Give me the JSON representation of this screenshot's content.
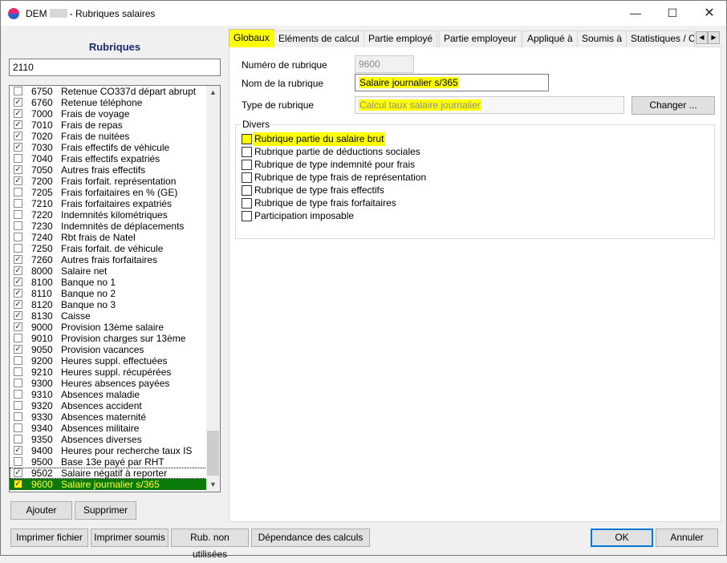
{
  "window": {
    "title_prefix": "DEM",
    "title_suffix": "- Rubriques salaires",
    "minimize": "—",
    "maximize": "☐",
    "close": "✕"
  },
  "left": {
    "header": "Rubriques",
    "search_value": "2110",
    "items": [
      {
        "code": "6750",
        "label": "Retenue CO337d départ abrupt",
        "checked": false
      },
      {
        "code": "6760",
        "label": "Retenue téléphone",
        "checked": true
      },
      {
        "code": "7000",
        "label": "Frais de voyage",
        "checked": true
      },
      {
        "code": "7010",
        "label": "Frais de repas",
        "checked": true
      },
      {
        "code": "7020",
        "label": "Frais de nuitées",
        "checked": true
      },
      {
        "code": "7030",
        "label": "Frais effectifs de véhicule",
        "checked": true
      },
      {
        "code": "7040",
        "label": "Frais effectifs expatriés",
        "checked": false
      },
      {
        "code": "7050",
        "label": "Autres frais effectifs",
        "checked": true
      },
      {
        "code": "7200",
        "label": "Frais forfait. représentation",
        "checked": true
      },
      {
        "code": "7205",
        "label": "Frais forfaitaires en % (GE)",
        "checked": false
      },
      {
        "code": "7210",
        "label": "Frais forfaitaires expatriés",
        "checked": false
      },
      {
        "code": "7220",
        "label": "Indemnités kilométriques",
        "checked": false
      },
      {
        "code": "7230",
        "label": "Indemnités de déplacements",
        "checked": false
      },
      {
        "code": "7240",
        "label": "Rbt frais de Natel",
        "checked": false
      },
      {
        "code": "7250",
        "label": "Frais forfait. de véhicule",
        "checked": false
      },
      {
        "code": "7260",
        "label": "Autres frais forfaitaires",
        "checked": true
      },
      {
        "code": "8000",
        "label": "Salaire net",
        "checked": true
      },
      {
        "code": "8100",
        "label": "Banque no 1",
        "checked": true
      },
      {
        "code": "8110",
        "label": "Banque no 2",
        "checked": true
      },
      {
        "code": "8120",
        "label": "Banque no 3",
        "checked": true
      },
      {
        "code": "8130",
        "label": "Caisse",
        "checked": true
      },
      {
        "code": "9000",
        "label": "Provision 13ème salaire",
        "checked": true
      },
      {
        "code": "9010",
        "label": "Provision charges sur 13ème",
        "checked": false
      },
      {
        "code": "9050",
        "label": "Provision vacances",
        "checked": true
      },
      {
        "code": "9200",
        "label": "Heures suppl. effectuées",
        "checked": false
      },
      {
        "code": "9210",
        "label": "Heures suppl. récupérées",
        "checked": false
      },
      {
        "code": "9300",
        "label": "Heures absences payées",
        "checked": false
      },
      {
        "code": "9310",
        "label": "Absences maladie",
        "checked": false
      },
      {
        "code": "9320",
        "label": "Absences accident",
        "checked": false
      },
      {
        "code": "9330",
        "label": "Absences maternité",
        "checked": false
      },
      {
        "code": "9340",
        "label": "Absences militaire",
        "checked": false
      },
      {
        "code": "9350",
        "label": "Absences diverses",
        "checked": false
      },
      {
        "code": "9400",
        "label": "Heures pour recherche taux IS",
        "checked": true
      },
      {
        "code": "9500",
        "label": "Base 13e payé par RHT",
        "checked": false
      },
      {
        "code": "9502",
        "label": "Salaire négatif à reporter",
        "checked": true
      },
      {
        "code": "9600",
        "label": "Salaire journalier s/365",
        "checked": true
      }
    ],
    "scroll_up": "▲",
    "scroll_down": "▼",
    "add_button": "Ajouter",
    "delete_button": "Supprimer"
  },
  "footer": {
    "print_file": "Imprimer fichier",
    "print_submitted": "Imprimer soumis",
    "unused": "Rub. non utilisées",
    "dependencies": "Dépendance des calculs",
    "ok": "OK",
    "cancel": "Annuler"
  },
  "tabs": [
    "Globaux",
    "Eléments de calcul",
    "Partie employé",
    "Partie employeur",
    "Appliqué à",
    "Soumis à",
    "Statistiques / C"
  ],
  "tab_scroll_left": "◀",
  "tab_scroll_right": "▶",
  "form": {
    "number_label": "Numéro de rubrique",
    "number_value": "9600",
    "name_label": "Nom de la rubrique",
    "name_value": "Salaire journalier s/365",
    "type_label": "Type de rubrique",
    "type_value": "Calcul taux salaire journalier",
    "change_button": "Changer ...",
    "group_title": "Divers",
    "options": [
      {
        "label": "Rubrique partie du salaire brut",
        "checked": false,
        "highlight": true
      },
      {
        "label": "Rubrique partie de déductions sociales",
        "checked": false,
        "highlight": false
      },
      {
        "label": "Rubrique de type indemnité pour frais",
        "checked": false,
        "highlight": false
      },
      {
        "label": "Rubrique de type frais de représentation",
        "checked": false,
        "highlight": false
      },
      {
        "label": "Rubrique de type frais effectifs",
        "checked": false,
        "highlight": false
      },
      {
        "label": "Rubrique de type frais forfaitaires",
        "checked": false,
        "highlight": false
      },
      {
        "label": "Participation imposable",
        "checked": false,
        "highlight": false
      }
    ]
  },
  "colors": {
    "highlight": "#ffff00",
    "selected_row": "#0b7a0b",
    "header_text": "#1c2a6e"
  }
}
